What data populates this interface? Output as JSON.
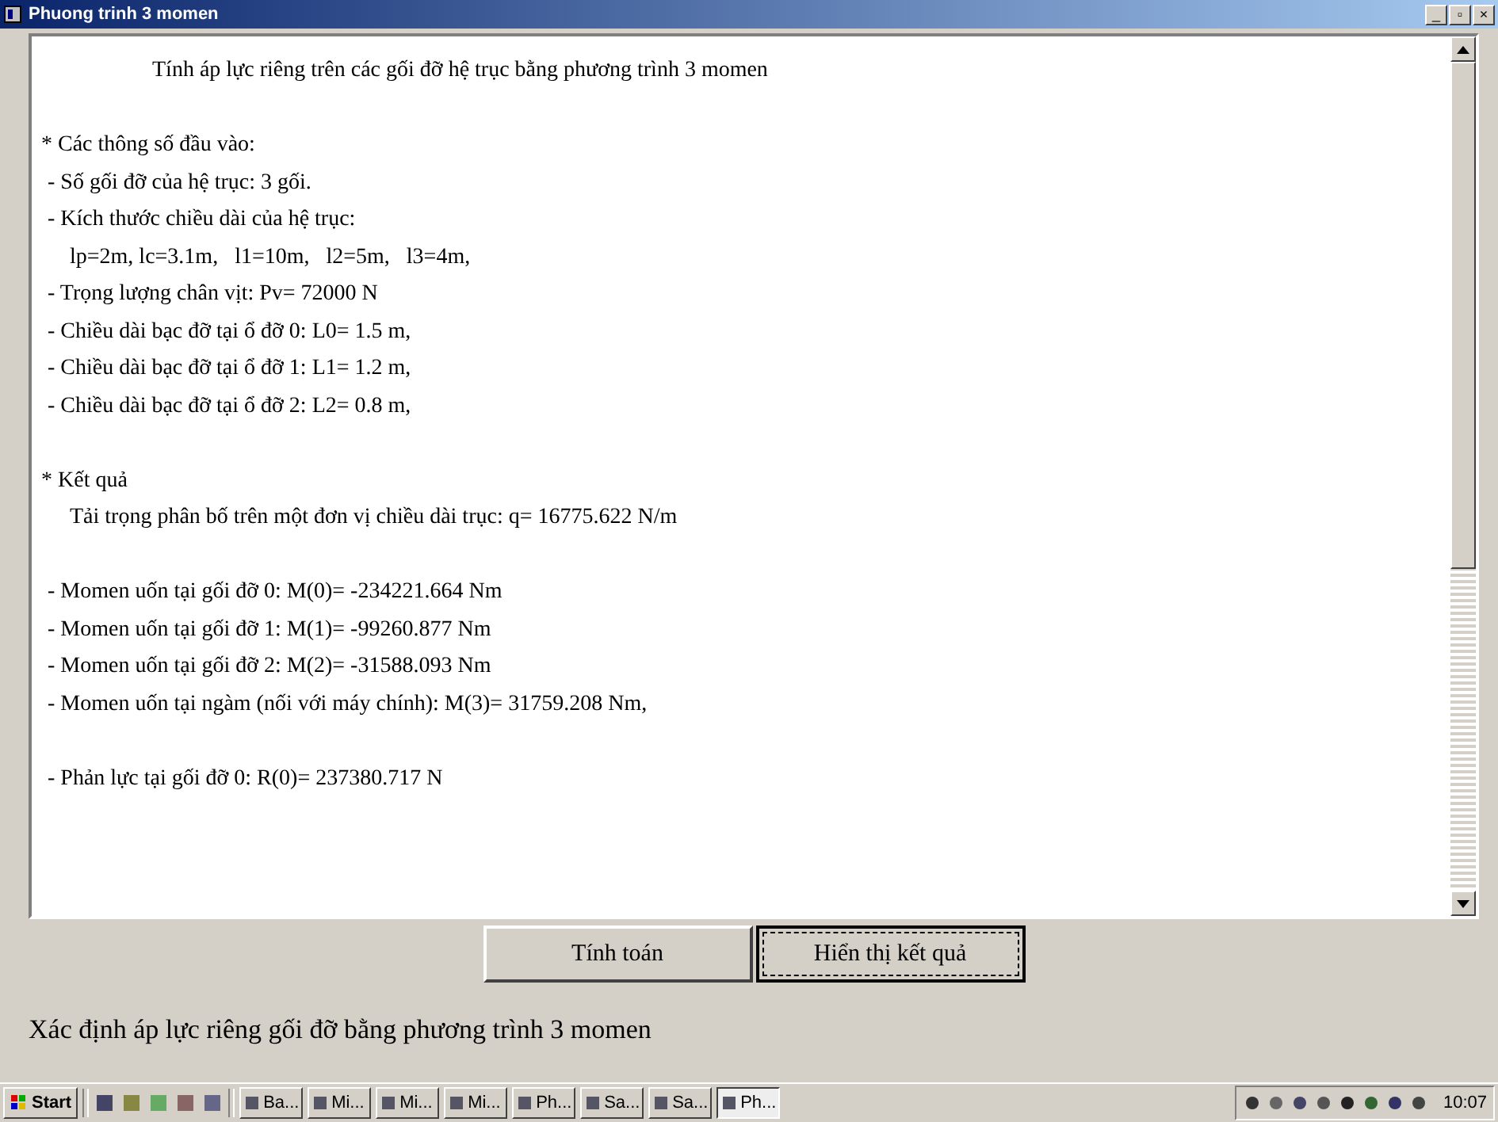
{
  "window": {
    "title": "Phuong trinh 3 momen",
    "controls": [
      "_",
      "▫",
      "×"
    ]
  },
  "output": {
    "blocks": [
      {
        "lines": [
          {
            "kind": "title",
            "text": "Tính áp lực riêng trên các gối đỡ hệ trục bằng phương trình 3 momen"
          }
        ]
      },
      {
        "lines": [
          {
            "kind": "heading",
            "text": "* Các thông số đầu vào:"
          },
          {
            "kind": "item",
            "text": "- Số gối đỡ của hệ trục: 3 gối."
          },
          {
            "kind": "item",
            "text": "- Kích thước chiều dài của hệ trục:"
          },
          {
            "kind": "sub",
            "text": "lp=2m, lc=3.1m,   l1=10m,   l2=5m,   l3=4m,"
          },
          {
            "kind": "item",
            "text": "- Trọng lượng chân vịt: Pv= 72000 N"
          },
          {
            "kind": "item",
            "text": "- Chiều dài bạc đỡ tại ổ đỡ 0: L0= 1.5 m,"
          },
          {
            "kind": "item",
            "text": "- Chiều dài bạc đỡ tại ổ đỡ 1: L1= 1.2 m,"
          },
          {
            "kind": "item",
            "text": "- Chiều dài bạc đỡ tại ổ đỡ 2: L2= 0.8 m,"
          }
        ]
      },
      {
        "lines": [
          {
            "kind": "heading",
            "text": "* Kết quả"
          },
          {
            "kind": "sub",
            "text": "Tải trọng phân bố trên một đơn vị chiều dài trục: q= 16775.622 N/m"
          }
        ]
      },
      {
        "lines": [
          {
            "kind": "item",
            "text": "- Momen uốn tại gối đỡ 0: M(0)= -234221.664 Nm"
          },
          {
            "kind": "item",
            "text": "- Momen uốn tại gối đỡ 1: M(1)= -99260.877 Nm"
          },
          {
            "kind": "item",
            "text": "- Momen uốn tại gối đỡ 2: M(2)= -31588.093 Nm"
          },
          {
            "kind": "item",
            "text": "- Momen uốn tại ngàm (nối với máy chính): M(3)= 31759.208 Nm,"
          }
        ]
      },
      {
        "lines": [
          {
            "kind": "item",
            "text": "- Phản lực tại gối đỡ 0: R(0)= 237380.717 N"
          }
        ]
      }
    ]
  },
  "buttons": [
    {
      "label": "Tính toán",
      "focused": false
    },
    {
      "label": "Hiển thị kết quả",
      "focused": true
    }
  ],
  "status_label": "Xác định áp lực riêng gối đỡ bằng phương trình 3 momen",
  "taskbar": {
    "start": "Start",
    "tasks": [
      {
        "label": "Ba...",
        "selected": false
      },
      {
        "label": "Mi...",
        "selected": false
      },
      {
        "label": "Mi...",
        "selected": false
      },
      {
        "label": "Mi...",
        "selected": false
      },
      {
        "label": "Ph...",
        "selected": false
      },
      {
        "label": "Sa...",
        "selected": false
      },
      {
        "label": "Sa...",
        "selected": false
      },
      {
        "label": "Ph...",
        "selected": true
      }
    ],
    "clock": "10:07"
  }
}
